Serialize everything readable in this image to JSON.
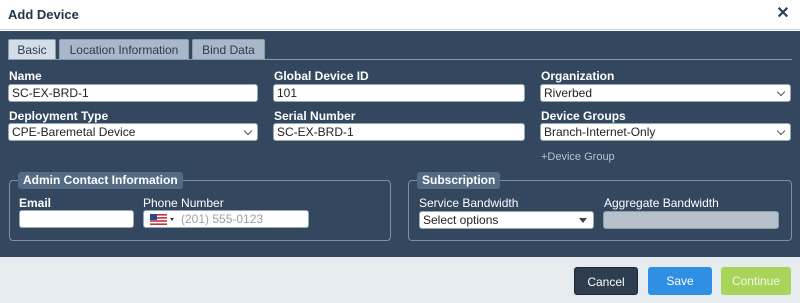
{
  "dialog": {
    "title": "Add Device",
    "close_icon": "✕"
  },
  "tabs": [
    {
      "label": "Basic"
    },
    {
      "label": "Location Information"
    },
    {
      "label": "Bind Data"
    }
  ],
  "fields": {
    "name": {
      "label": "Name",
      "value": "SC-EX-BRD-1"
    },
    "global_device_id": {
      "label": "Global Device ID",
      "value": "101"
    },
    "organization": {
      "label": "Organization",
      "value": "Riverbed"
    },
    "deployment_type": {
      "label": "Deployment Type",
      "value": "CPE-Baremetal Device"
    },
    "serial_number": {
      "label": "Serial Number",
      "value": "SC-EX-BRD-1"
    },
    "device_groups": {
      "label": "Device Groups",
      "value": "Branch-Internet-Only"
    }
  },
  "add_device_group_link": "+Device Group",
  "admin_contact": {
    "legend": "Admin Contact Information",
    "email_label": "Email",
    "email_value": "",
    "phone_label": "Phone Number",
    "phone_placeholder": "(201) 555-0123",
    "flag_icon": "us-flag-icon"
  },
  "subscription": {
    "legend": "Subscription",
    "service_bandwidth_label": "Service Bandwidth",
    "service_bandwidth_value": "Select options",
    "aggregate_bandwidth_label": "Aggregate Bandwidth",
    "aggregate_bandwidth_value": ""
  },
  "buttons": {
    "cancel": "Cancel",
    "save": "Save",
    "continue": "Continue"
  },
  "colors": {
    "panel": "#33475e",
    "save": "#2f8fe3",
    "continue": "#a8d45a",
    "cancel": "#2e3d4f"
  }
}
